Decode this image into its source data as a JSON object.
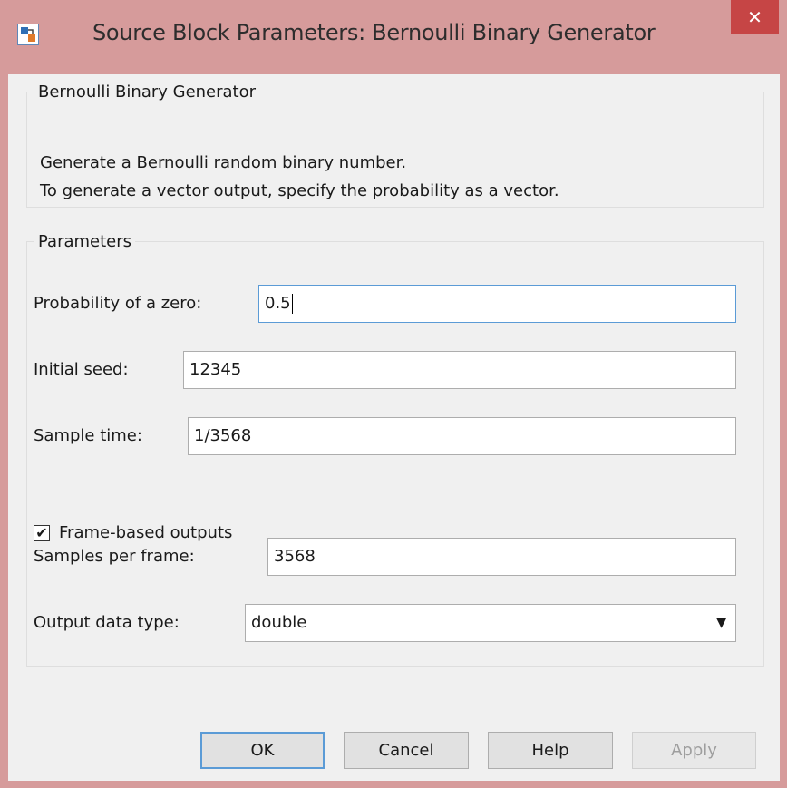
{
  "window": {
    "title": "Source Block Parameters: Bernoulli Binary Generator",
    "icon": "simulink-block-icon",
    "close_glyph": "✕"
  },
  "description": {
    "group_title": "Bernoulli Binary Generator",
    "line1": "Generate a Bernoulli random binary number.",
    "line2": "To generate a vector output, specify the probability as a vector."
  },
  "parameters": {
    "group_title": "Parameters",
    "probability": {
      "label": "Probability of a zero:",
      "value": "0.5"
    },
    "seed": {
      "label": "Initial seed:",
      "value": "12345"
    },
    "sample_time": {
      "label": "Sample time:",
      "value": "1/3568"
    },
    "frame_based": {
      "label": "Frame-based outputs",
      "checked": true,
      "check_glyph": "✔"
    },
    "samples_per_frame": {
      "label": "Samples per frame:",
      "value": "3568"
    },
    "output_type": {
      "label": "Output data type:",
      "value": "double",
      "arrow": "▼"
    }
  },
  "buttons": {
    "ok": "OK",
    "cancel": "Cancel",
    "help": "Help",
    "apply": "Apply"
  },
  "colors": {
    "titlebar": "#d69b9b",
    "close": "#c64545",
    "focus": "#5b9bd6"
  }
}
